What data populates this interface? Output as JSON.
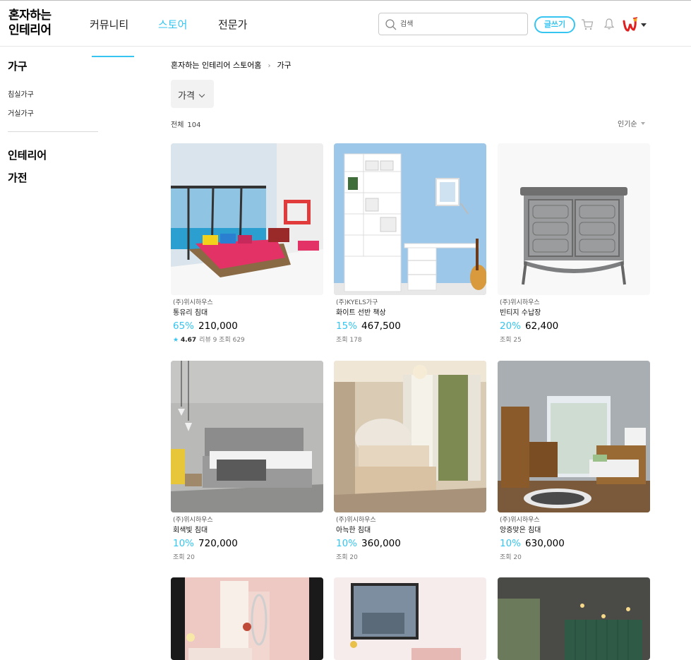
{
  "header": {
    "logo": [
      "혼자하는",
      "인테리어"
    ],
    "nav": [
      {
        "label": "커뮤니티",
        "active": false
      },
      {
        "label": "스토어",
        "active": true
      },
      {
        "label": "전문가",
        "active": false
      }
    ],
    "search_placeholder": "검색",
    "write_label": "글쓰기",
    "accent_color": "#35c5f0"
  },
  "sidebar": {
    "title": "가구",
    "subs": [
      "침실가구",
      "거실가구"
    ],
    "cats": [
      "인테리어",
      "가전"
    ]
  },
  "main": {
    "breadcrumb": [
      "혼자하는 인테리어 스토어홈",
      "가구"
    ],
    "filter_label": "가격",
    "total_label": "전체",
    "total_count": "104",
    "sort_label": "인기순"
  },
  "products": [
    {
      "brand": "(주)위시하우스",
      "name": "통유리 침대",
      "discount": "65%",
      "price": "210,000",
      "rating": "4.67",
      "meta": "리뷰 9 조회 629"
    },
    {
      "brand": "(주)KYELS가구",
      "name": "화이트 선반 책상",
      "discount": "15%",
      "price": "467,500",
      "meta": "조회 178"
    },
    {
      "brand": "(주)위시하우스",
      "name": "빈티지 수납장",
      "discount": "20%",
      "price": "62,400",
      "meta": "조회 25"
    },
    {
      "brand": "(주)위시하우스",
      "name": "회색빛 침대",
      "discount": "10%",
      "price": "720,000",
      "meta": "조회 20"
    },
    {
      "brand": "(주)위시하우스",
      "name": "아늑한 침대",
      "discount": "10%",
      "price": "360,000",
      "meta": "조회 20"
    },
    {
      "brand": "(주)위시하우스",
      "name": "앙증맞은 침대",
      "discount": "10%",
      "price": "630,000",
      "meta": "조회 20"
    }
  ]
}
